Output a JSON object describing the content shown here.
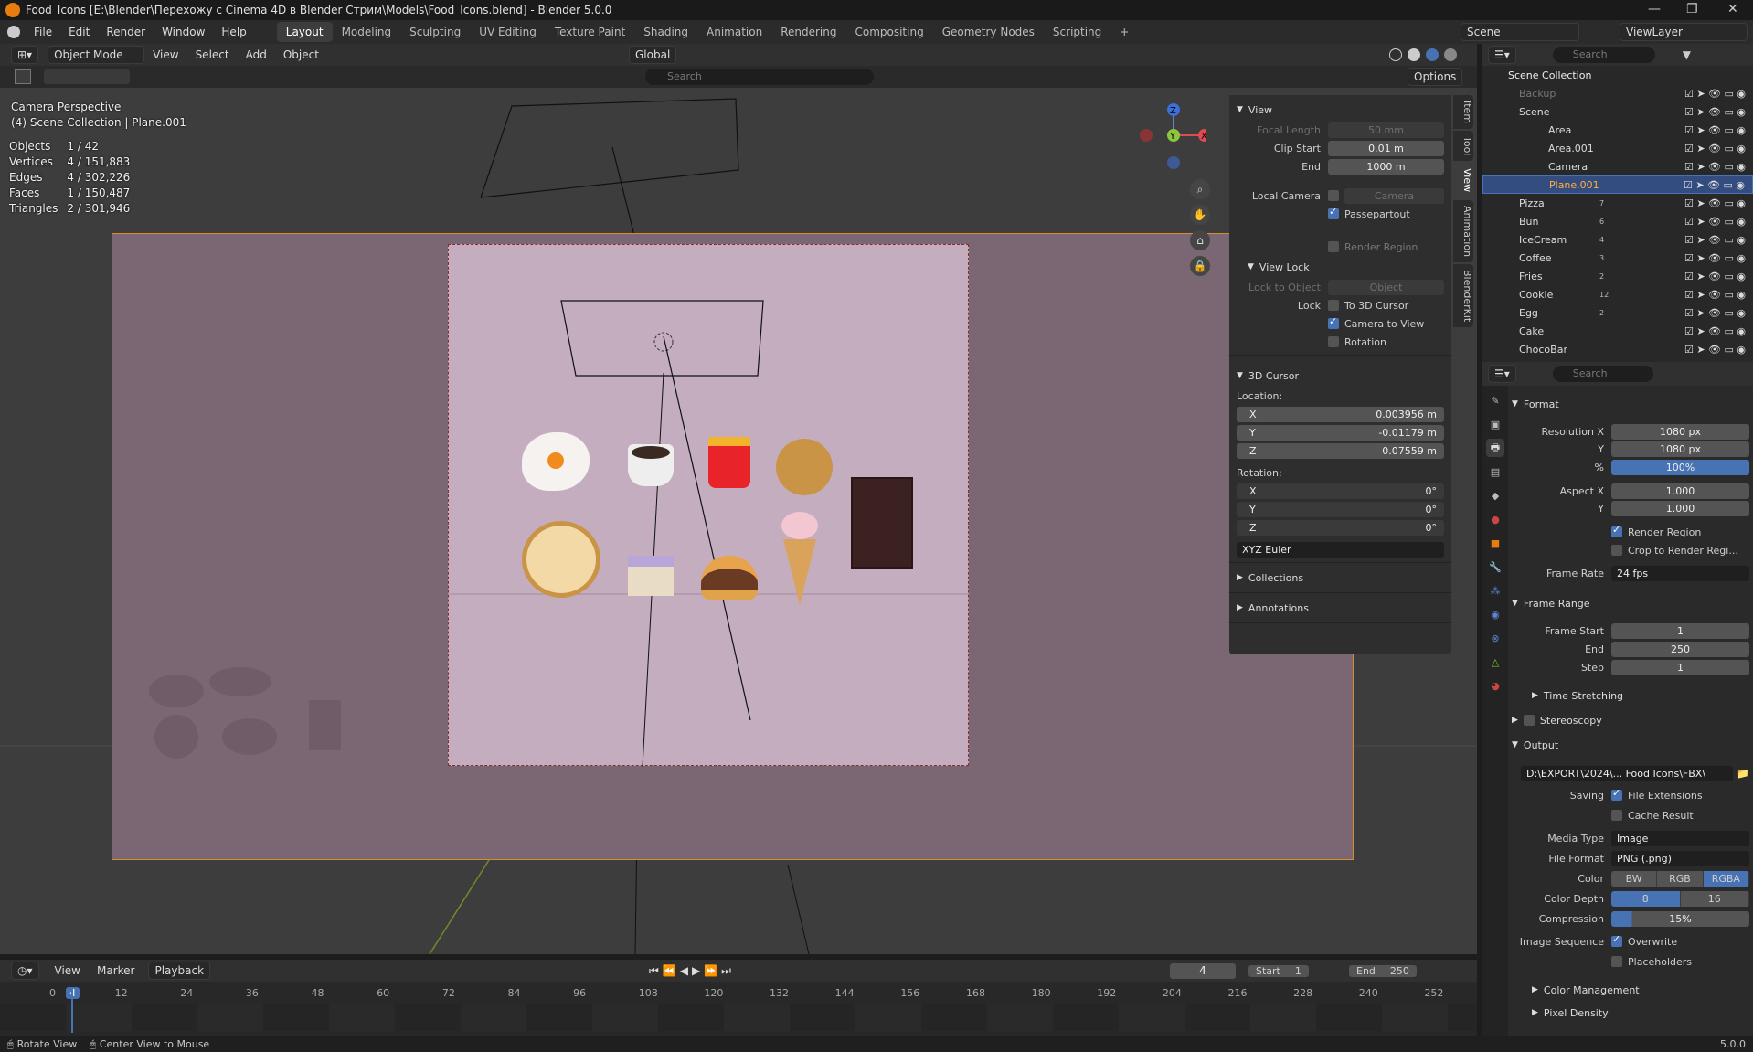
{
  "window": {
    "title": "Food_Icons [E:\\Blender\\Перехожу с Cinema 4D в Blender Стрим\\Models\\Food_Icons.blend] - Blender 5.0.0"
  },
  "menu": [
    "File",
    "Edit",
    "Render",
    "Window",
    "Help"
  ],
  "workspaces": [
    "Layout",
    "Modeling",
    "Sculpting",
    "UV Editing",
    "Texture Paint",
    "Shading",
    "Animation",
    "Rendering",
    "Compositing",
    "Geometry Nodes",
    "Scripting",
    "+"
  ],
  "scene_selector": "Scene",
  "viewlayer_selector": "ViewLayer",
  "vp_header": {
    "mode": "Object Mode",
    "menus": [
      "View",
      "Select",
      "Add",
      "Object"
    ],
    "orientation": "Global",
    "options": "Options",
    "search_placeholder": "Search"
  },
  "overlay": {
    "line1": "Camera Perspective",
    "line2": "(4) Scene Collection | Plane.001",
    "stats": [
      {
        "k": "Objects",
        "v": "1 / 42"
      },
      {
        "k": "Vertices",
        "v": "4 / 151,883"
      },
      {
        "k": "Edges",
        "v": "4 / 302,226"
      },
      {
        "k": "Faces",
        "v": "1 / 150,487"
      },
      {
        "k": "Triangles",
        "v": "2 / 301,946"
      }
    ]
  },
  "gizmo": {
    "z": "Z",
    "y": "Y",
    "x": "X"
  },
  "npanel": {
    "tabs": [
      "Item",
      "Tool",
      "View",
      "Animation",
      "BlenderKit"
    ],
    "view": {
      "title": "View",
      "focal_length_lbl": "Focal Length",
      "focal_length": "50 mm",
      "clip_start_lbl": "Clip Start",
      "clip_start": "0.01 m",
      "end_lbl": "End",
      "end": "1000 m",
      "local_camera_lbl": "Local Camera",
      "local_camera": "Camera",
      "passepartout": "Passepartout",
      "render_region": "Render Region"
    },
    "view_lock": {
      "title": "View Lock",
      "lock_obj_lbl": "Lock to Object",
      "lock_obj_ph": "Object",
      "lock_lbl": "Lock",
      "to_cursor": "To 3D Cursor",
      "cam_to_view": "Camera to View",
      "rotation": "Rotation"
    },
    "cursor": {
      "title": "3D Cursor",
      "location": "Location:",
      "x": "0.003956 m",
      "y": "-0.01179 m",
      "z": "0.07559 m",
      "rotation": "Rotation:",
      "rx": "0°",
      "ry": "0°",
      "rz": "0°",
      "mode": "XYZ Euler",
      "lx": "X",
      "ly": "Y",
      "lz": "Z"
    },
    "collections": "Collections",
    "annotations": "Annotations"
  },
  "outliner": {
    "search_ph": "Search",
    "root": "Scene Collection",
    "rows": [
      {
        "name": "Backup",
        "indent": 1,
        "dim": true
      },
      {
        "name": "Scene",
        "indent": 1
      },
      {
        "name": "Area",
        "indent": 2
      },
      {
        "name": "Area.001",
        "indent": 2
      },
      {
        "name": "Camera",
        "indent": 2
      },
      {
        "name": "Plane.001",
        "indent": 2,
        "sel": true
      },
      {
        "name": "Pizza",
        "indent": 1,
        "n": "7"
      },
      {
        "name": "Bun",
        "indent": 1,
        "n": "6"
      },
      {
        "name": "IceCream",
        "indent": 1,
        "n": "4"
      },
      {
        "name": "Coffee",
        "indent": 1,
        "n": "3"
      },
      {
        "name": "Fries",
        "indent": 1,
        "n": "2"
      },
      {
        "name": "Cookie",
        "indent": 1,
        "n": "12"
      },
      {
        "name": "Egg",
        "indent": 1,
        "n": "2"
      },
      {
        "name": "Cake",
        "indent": 1
      },
      {
        "name": "ChocoBar",
        "indent": 1
      }
    ]
  },
  "props": {
    "search_ph": "Search",
    "format": {
      "title": "Format",
      "res_x_lbl": "Resolution X",
      "res_x": "1080 px",
      "res_y_lbl": "Y",
      "res_y": "1080 px",
      "pct_lbl": "%",
      "pct": "100%",
      "asp_x_lbl": "Aspect X",
      "asp_x": "1.000",
      "asp_y_lbl": "Y",
      "asp_y": "1.000",
      "render_region": "Render Region",
      "crop": "Crop to Render Regi...",
      "fps_lbl": "Frame Rate",
      "fps": "24 fps"
    },
    "frame_range": {
      "title": "Frame Range",
      "start_lbl": "Frame Start",
      "start": "1",
      "end_lbl": "End",
      "end": "250",
      "step_lbl": "Step",
      "step": "1",
      "time_stretch": "Time Stretching"
    },
    "stereoscopy": "Stereoscopy",
    "output": {
      "title": "Output",
      "path": "D:\\EXPORT\\2024\\... Food Icons\\FBX\\",
      "saving_lbl": "Saving",
      "file_ext": "File Extensions",
      "cache": "Cache Result",
      "media_lbl": "Media Type",
      "media": "Image",
      "format_lbl": "File Format",
      "format": "PNG (.png)",
      "color_lbl": "Color",
      "color_opts": [
        "BW",
        "RGB",
        "RGBA"
      ],
      "depth_lbl": "Color Depth",
      "depth_opts": [
        "8",
        "16"
      ],
      "comp_lbl": "Compression",
      "comp": "15%",
      "seq_lbl": "Image Sequence",
      "overwrite": "Overwrite",
      "placeholders": "Placeholders",
      "color_mgmt": "Color Management",
      "pixel_density": "Pixel Density"
    }
  },
  "timeline": {
    "menus": [
      "View",
      "Marker",
      "Playback"
    ],
    "current_frame": "4",
    "start_lbl": "Start",
    "start": "1",
    "end_lbl": "End",
    "end": "250",
    "ticks": [
      "0",
      "4",
      "12",
      "24",
      "36",
      "48",
      "60",
      "72",
      "84",
      "96",
      "108",
      "120",
      "132",
      "144",
      "156",
      "168",
      "180",
      "192",
      "204",
      "216",
      "228",
      "240",
      "252"
    ]
  },
  "status": {
    "left1": "Rotate View",
    "left2": "Center View to Mouse",
    "version": "5.0.0"
  },
  "colors": {
    "accent": "#4772b3",
    "orange": "#e87d0d",
    "selected_row": "#334d80"
  }
}
